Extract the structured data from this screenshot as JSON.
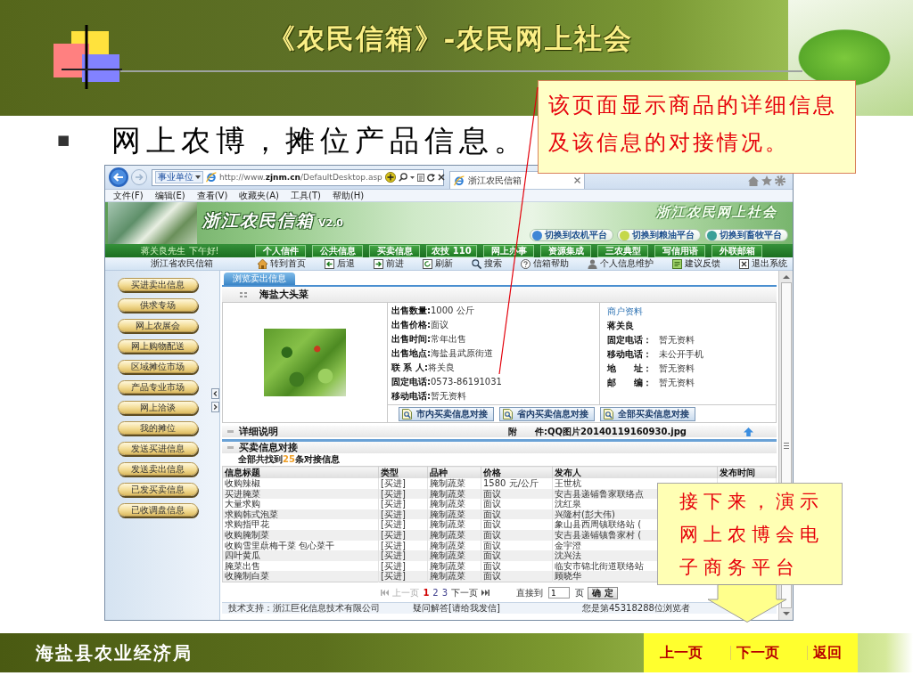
{
  "slide": {
    "title": "《农民信箱》-农民网上社会",
    "bullet": "■",
    "heading": "网上农博，摊位产品信息。",
    "organization": "海盐县农业经济局",
    "nav": [
      "上一页",
      "下一页",
      "返回"
    ]
  },
  "note_callout": {
    "text": "该页面显示商品的详细信息及该信息的对接情况。"
  },
  "next_callout": {
    "text": "接下来，演示网上农博会电子商务平台"
  },
  "browser": {
    "favorites": "事业单位",
    "url": "http://www.**zjnm.cn**/DefaultDesktop.asp",
    "tab": "浙江农民信箱",
    "menu": [
      "文件(F)",
      "编辑(E)",
      "查看(V)",
      "收藏夹(A)",
      "工具(T)",
      "帮助(H)"
    ]
  },
  "site": {
    "logo": "浙江农民信箱",
    "version": "V2.0",
    "slogan": "浙江农民网上社会",
    "platforms": [
      {
        "label": "切换到农机平台",
        "color": "#3f86d6"
      },
      {
        "label": "切换到粮油平台",
        "color": "#c5d84a"
      },
      {
        "label": "切换到畜牧平台",
        "color": "#3a9f98"
      }
    ],
    "greeting": "蒋关良先生 下午好!",
    "nav": [
      "个人信件",
      "公共信息",
      "买卖信息",
      "农技 110",
      "网上办事",
      "资源集成",
      "三农典型",
      "写信用语",
      "外联邮箱"
    ],
    "site_name": "浙江省农民信箱",
    "toolbar": [
      "转到首页",
      "后退",
      "前进",
      "刷新",
      "搜索",
      "信箱帮助",
      "个人信息维护",
      "建议反馈",
      "退出系统"
    ],
    "sidebar": [
      "买进卖出信息",
      "供求专场",
      "网上农展会",
      "网上购物配送",
      "区域摊位市场",
      "产品专业市场",
      "网上洽谈",
      "我的摊位",
      "发送买进信息",
      "发送卖出信息",
      "已发买卖信息",
      "已收调盘信息"
    ]
  },
  "content": {
    "tabs": [
      {
        "label": "浏览卖出信息",
        "selected": true
      }
    ],
    "product_title": "海盐大头菜",
    "details": [
      {
        "label": "出售数量:",
        "value": "1000 公斤"
      },
      {
        "label": "出售价格:",
        "value": "面议"
      },
      {
        "label": "出售时间:",
        "value": "常年出售"
      },
      {
        "label": "出售地点:",
        "value": "海盐县武原街道"
      },
      {
        "label": "联 系 人:",
        "value": "将关良"
      },
      {
        "label": "固定电话:",
        "value": "0573-86191031"
      },
      {
        "label": "移动电话:",
        "value": "暂无资料"
      }
    ],
    "merchant": {
      "heading": "商户资料",
      "name": "蒋关良",
      "fields": [
        {
          "label": "固定电话：",
          "value": "暂无资料"
        },
        {
          "label": "移动电话：",
          "value": "未公开手机"
        },
        {
          "label": "地　　址：",
          "value": "暂无资料"
        },
        {
          "label": "邮　　编：",
          "value": "暂无资料"
        }
      ]
    },
    "match_buttons": [
      "市内买卖信息对接",
      "省内买卖信息对接",
      "全部买卖信息对接"
    ],
    "detail_section": {
      "title": "详细说明",
      "attachment": "附　　件:QQ图片20140119160930.jpg"
    },
    "match_section": {
      "title": "买卖信息对接",
      "summary_prefix": "全部共找到",
      "count": "25",
      "summary_suffix": "条对接信息"
    },
    "table": {
      "columns": [
        "信息标题",
        "类型",
        "品种",
        "价格",
        "发布人",
        "发布时间"
      ],
      "rows": [
        [
          "收购辣椒",
          "[买进]",
          "腌制蔬菜",
          "1580 元/公斤",
          "王世杭"
        ],
        [
          "买进腌菜",
          "[买进]",
          "腌制蔬菜",
          "面议",
          "安吉县递铺鲁家联络点"
        ],
        [
          "大量求购",
          "[买进]",
          "腌制蔬菜",
          "面议",
          "沈红泉"
        ],
        [
          "求购韩式泡菜",
          "[买进]",
          "腌制蔬菜",
          "面议",
          "兴隆村(彭大伟)"
        ],
        [
          "求购指甲花",
          "[买进]",
          "腌制蔬菜",
          "面议",
          "象山县西周镇联络站 ("
        ],
        [
          "收购腌制菜",
          "[买进]",
          "腌制蔬菜",
          "面议",
          "安吉县递铺镇鲁家村 ("
        ],
        [
          "收购雪里蕻梅干菜 包心菜干",
          "[买进]",
          "腌制蔬菜",
          "面议",
          "金宇澄"
        ],
        [
          "四叶黄瓜",
          "[买进]",
          "腌制蔬菜",
          "面议",
          "沈兴法"
        ],
        [
          "腌菜出售",
          "[买进]",
          "腌制蔬菜",
          "面议",
          "临安市锦北街道联络站"
        ],
        [
          "收腌制白菜",
          "[买进]",
          "腌制蔬菜",
          "面议",
          "顾晓华"
        ]
      ]
    },
    "pagination": {
      "prev": {
        "label": "上一页",
        "disabled": true
      },
      "pages": [
        {
          "label": "1",
          "selected": true
        },
        {
          "label": "2",
          "selected": false
        },
        {
          "label": "3",
          "selected": false
        }
      ],
      "next": {
        "label": "下一页",
        "disabled": false
      },
      "goto_label": "直接到",
      "goto_value": "1",
      "goto_unit": "页",
      "confirm": "确 定"
    },
    "footer": [
      "技术支持：浙江巨化信息技术有限公司",
      "疑问解答[请给我发信]",
      "您是第45318288位浏览者"
    ]
  }
}
